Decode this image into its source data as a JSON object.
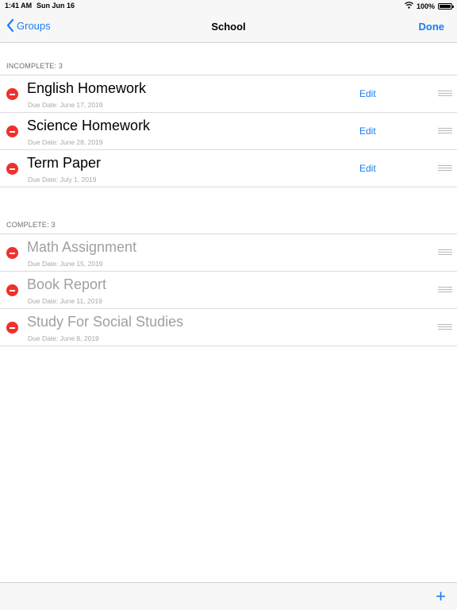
{
  "status_bar": {
    "time": "1:41 AM",
    "date": "Sun Jun 16",
    "battery": "100%",
    "battery_level": 1.0
  },
  "nav_bar": {
    "back_label": "Groups",
    "title": "School",
    "done_label": "Done"
  },
  "sections": {
    "incomplete": {
      "header": "INCOMPLETE: 3",
      "items": [
        {
          "title": "English Homework",
          "due": "Due Date: June 17, 2019",
          "edit_label": "Edit"
        },
        {
          "title": "Science Homework",
          "due": "Due Date: June 28, 2019",
          "edit_label": "Edit"
        },
        {
          "title": "Term Paper",
          "due": "Due Date: July 1, 2019",
          "edit_label": "Edit"
        }
      ]
    },
    "complete": {
      "header": "COMPLETE: 3",
      "items": [
        {
          "title": "Math Assignment",
          "due": "Due Date: June 15, 2019"
        },
        {
          "title": "Book Report",
          "due": "Due Date: June 11, 2019"
        },
        {
          "title": "Study For Social Studies",
          "due": "Due Date: June 8, 2019"
        }
      ]
    }
  },
  "toolbar": {
    "add_label": "+"
  },
  "colors": {
    "accent": "#1a7cf5",
    "delete": "#f0302b",
    "complete_text": "#a0a0a0"
  },
  "icons": {
    "back": "chevron-left-icon",
    "wifi": "wifi-icon",
    "battery": "battery-icon",
    "delete": "minus-circle-icon",
    "reorder": "reorder-handle-icon",
    "add": "plus-icon"
  }
}
